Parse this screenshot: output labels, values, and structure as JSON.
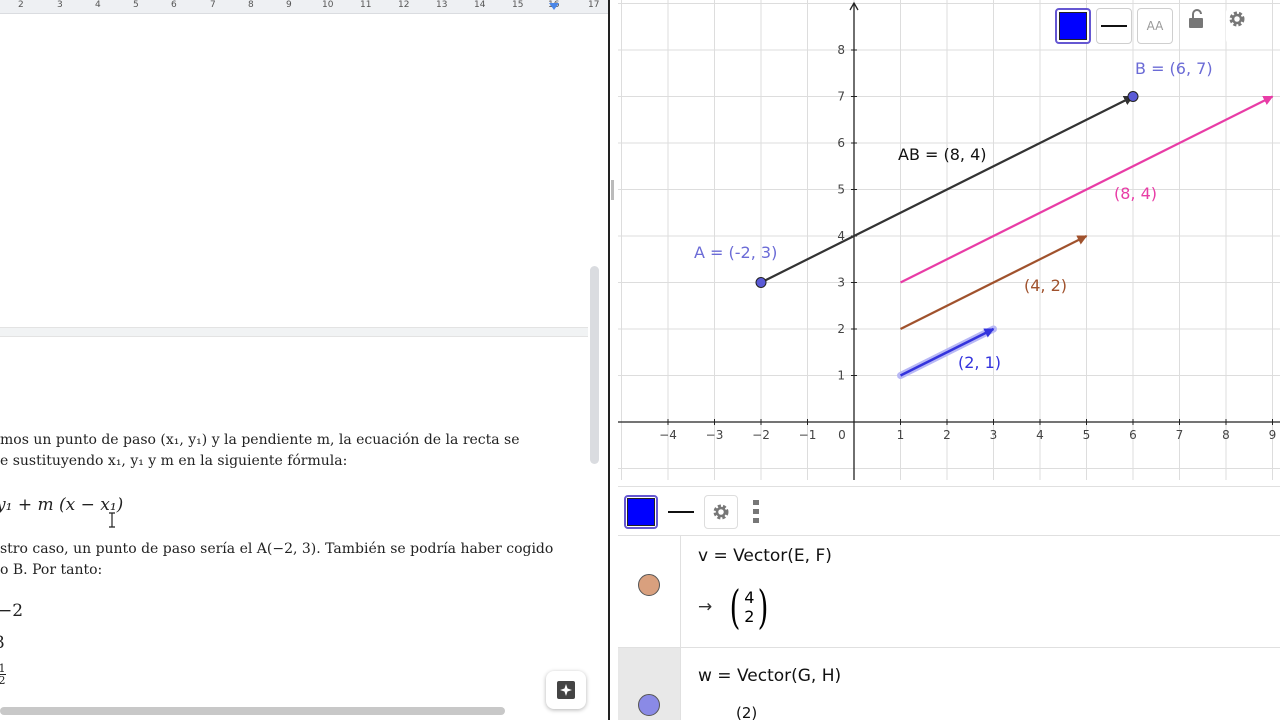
{
  "document": {
    "ruler_numbers": [
      "2",
      "3",
      "4",
      "5",
      "6",
      "7",
      "8",
      "9",
      "10",
      "11",
      "12",
      "13",
      "14",
      "15",
      "16",
      "17"
    ],
    "para1_line1": "mos un punto de paso (x₁, y₁) y la pendiente m, la ecuación de la recta se",
    "para1_line2": "e sustituyendo x₁, y₁ y m en la siguiente fórmula:",
    "formula": "y₁ + m (x − x₁)",
    "para2_line1": "stro caso, un punto de paso sería el A(−2, 3). También se podría haber cogido",
    "para2_line2": "o B. Por tanto:",
    "value1": "−2",
    "value2": "3",
    "value3_num": "1",
    "value3_den": "2"
  },
  "graph": {
    "x_ticks": [
      "−4",
      "−3",
      "−2",
      "−1",
      "0",
      "1",
      "2",
      "3",
      "4",
      "5",
      "6",
      "7",
      "8",
      "9"
    ],
    "y_ticks": [
      "1",
      "2",
      "3",
      "4",
      "5",
      "6",
      "7",
      "8"
    ],
    "label_A": "A = (-2, 3)",
    "label_B": "B = (6, 7)",
    "label_AB": "AB = (8, 4)",
    "label_v84": "(8, 4)",
    "label_v42": "(4, 2)",
    "label_v21": "(2, 1)",
    "colors": {
      "ab": "#333333",
      "pink": "#e83ca6",
      "brown": "#a0522d",
      "blue": "#3333dd",
      "point": "#5a5ad6",
      "point_label": "#6b6bd6"
    }
  },
  "graph_toolbar": {
    "buttons": [
      "color-swatch-blue",
      "line-style",
      "label-style",
      "lock-icon",
      "gear-icon"
    ],
    "label_style_text": "AA"
  },
  "algebra": {
    "row1_formula": "v  =  Vector(E, F)",
    "row1_arrow": "→",
    "row1_top": "4",
    "row1_bottom": "2",
    "row1_color": "#d9a07e",
    "row2_formula": "w  =  Vector(G, H)",
    "row2_partial": "(2)",
    "row2_color": "#8a8ae6"
  }
}
